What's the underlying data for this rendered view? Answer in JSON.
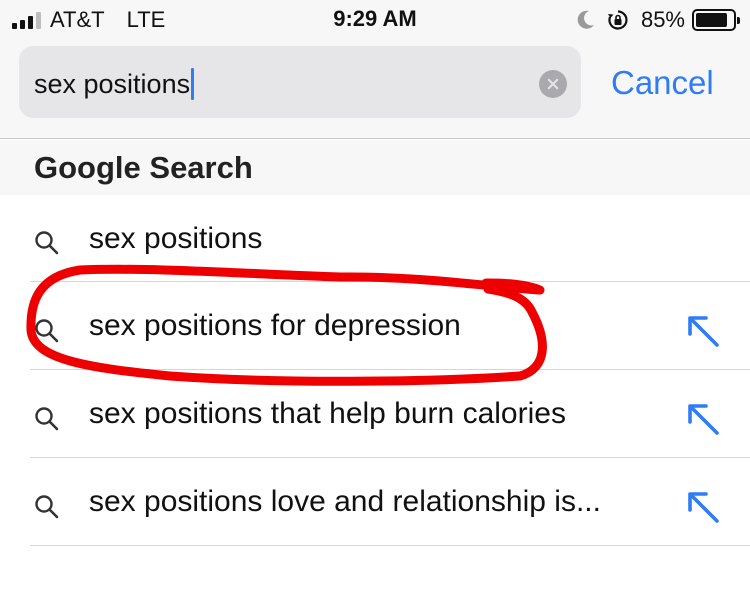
{
  "status_bar": {
    "carrier": "AT&T",
    "network": "LTE",
    "time": "9:29 AM",
    "battery_percent": "85%",
    "battery_level": 0.85,
    "icons": [
      "cellular-signal-icon",
      "do-not-disturb-moon-icon",
      "orientation-lock-icon",
      "battery-icon"
    ]
  },
  "search": {
    "query": "sex positions"
  },
  "cancel_label": "Cancel",
  "section_title": "Google Search",
  "suggestions": [
    {
      "text": "sex positions",
      "has_fill_arrow": false
    },
    {
      "text": "sex positions for depression",
      "has_fill_arrow": true
    },
    {
      "text": "sex positions that help burn calories",
      "has_fill_arrow": true
    },
    {
      "text": "sex positions love and relationship is...",
      "has_fill_arrow": true
    }
  ],
  "colors": {
    "accent": "#2f7cf6",
    "annotation_red": "#ee0000",
    "header_bg": "#f7f7f7",
    "field_bg": "#e6e6e9"
  }
}
